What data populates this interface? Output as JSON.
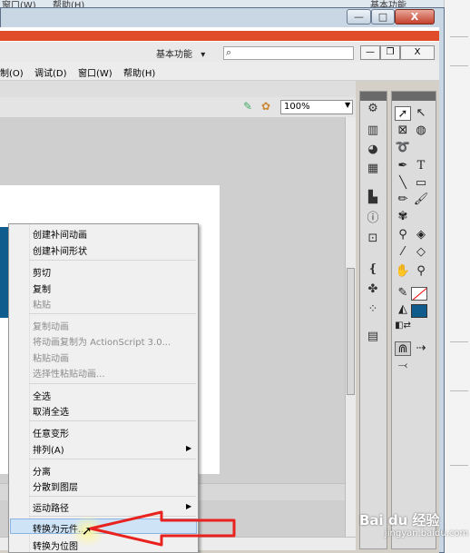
{
  "background": {
    "top_left_text": "窗口(W)",
    "top_mid_text": "帮助(H)",
    "top_right_text": "基本功能"
  },
  "window": {
    "minimize": "—",
    "maximize": "□",
    "close": "X"
  },
  "app": {
    "workspace": "基本功能",
    "workspace_arrow": "▾",
    "mdi_min": "—",
    "mdi_restore": "❐",
    "mdi_close": "X",
    "menu": [
      {
        "label": "制(O)"
      },
      {
        "label": "调试(D)"
      },
      {
        "label": "窗口(W)"
      },
      {
        "label": "帮助(H)"
      }
    ],
    "zoom": "100%",
    "zoom_arrow": "▼"
  },
  "context_menu": {
    "items": [
      {
        "label": "创建补间动画",
        "enabled": true
      },
      {
        "label": "创建补间形状",
        "enabled": true
      },
      {
        "label": "剪切",
        "enabled": true
      },
      {
        "label": "复制",
        "enabled": true
      },
      {
        "label": "粘贴",
        "enabled": false
      },
      {
        "label": "复制动画",
        "enabled": false
      },
      {
        "label": "将动画复制为 ActionScript 3.0...",
        "enabled": false
      },
      {
        "label": "粘贴动画",
        "enabled": false
      },
      {
        "label": "选择性粘贴动画...",
        "enabled": false
      },
      {
        "label": "全选",
        "enabled": true
      },
      {
        "label": "取消全选",
        "enabled": true
      },
      {
        "label": "任意变形",
        "enabled": true
      },
      {
        "label": "排列(A)",
        "enabled": true,
        "submenu": true
      },
      {
        "label": "分离",
        "enabled": true
      },
      {
        "label": "分散到图层",
        "enabled": true
      },
      {
        "label": "运动路径",
        "enabled": true,
        "submenu": true
      },
      {
        "label": "转换为元件...",
        "enabled": true,
        "highlighted": true
      },
      {
        "label": "转换为位图",
        "enabled": true
      }
    ]
  },
  "watermark": {
    "logo": "Bai du 经验",
    "url": "jingyan.baidu.com"
  },
  "colors": {
    "accent_red": "#e8231f",
    "stage_blue": "#0f5c8d",
    "highlight": "#cfe3f7"
  },
  "icons": [
    "selection-tool-icon",
    "subselection-tool-icon",
    "free-transform-icon",
    "3d-rotation-icon",
    "lasso-icon",
    "pen-icon",
    "text-icon",
    "line-icon",
    "rectangle-icon",
    "pencil-icon",
    "brush-icon",
    "deco-icon",
    "bone-icon",
    "paint-bucket-icon",
    "eyedropper-icon",
    "eraser-icon",
    "hand-icon",
    "zoom-icon",
    "stroke-color-icon",
    "fill-color-icon"
  ]
}
